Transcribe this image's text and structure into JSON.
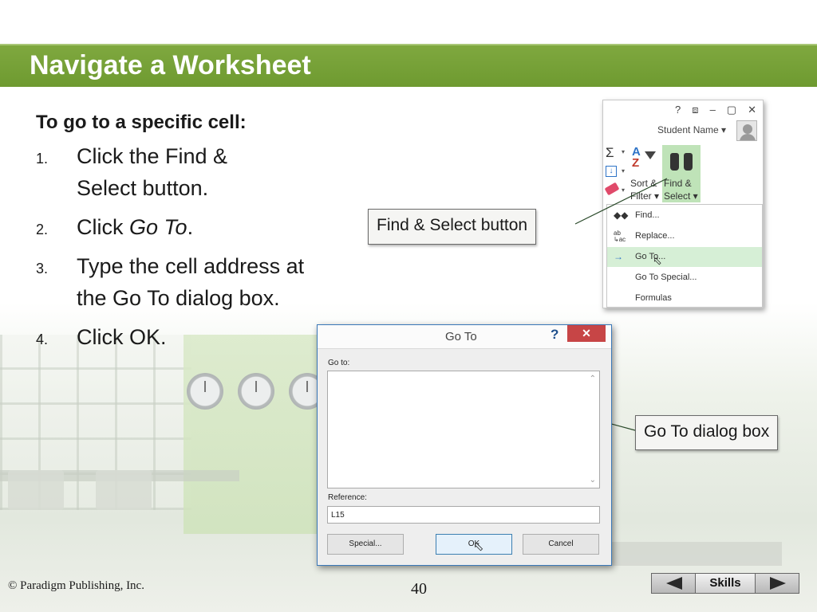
{
  "slide": {
    "title": "Navigate a Worksheet",
    "heading": "To go to a specific cell:",
    "steps": [
      {
        "num": "1.",
        "text_pre": "Click the Find & Select button.",
        "italic": "",
        "text_post": ""
      },
      {
        "num": "2.",
        "text_pre": "Click ",
        "italic": "Go To",
        "text_post": "."
      },
      {
        "num": "3.",
        "text_pre": "Type the cell address at the Go To dialog box.",
        "italic": "",
        "text_post": ""
      },
      {
        "num": "4.",
        "text_pre": "Click OK.",
        "italic": "",
        "text_post": ""
      }
    ]
  },
  "ribbon": {
    "window_controls": {
      "help": "?",
      "restore_ribbon": "⧈",
      "minimize": "–",
      "maximize": "🗗",
      "close": "✕"
    },
    "user_name": "Student Name ▾",
    "sort_filter_label_1": "Sort &",
    "sort_filter_label_2": "Filter ▾",
    "find_select_label_1": "Find &",
    "find_select_label_2": "Select ▾",
    "menu_items": [
      {
        "label": "Find...",
        "icon": "binoculars-icon",
        "glyph": "🔭"
      },
      {
        "label": "Replace...",
        "icon": "replace-icon",
        "glyph": "ab↳ac"
      },
      {
        "label": "Go To...",
        "icon": "arrow-right-icon",
        "glyph": "→"
      },
      {
        "label": "Go To Special...",
        "icon": "",
        "glyph": ""
      },
      {
        "label": "Formulas",
        "icon": "",
        "glyph": ""
      }
    ],
    "highlight_color": "#d6efd6"
  },
  "callouts": {
    "find_select": "Find & Select button",
    "goto_dialog": "Go To dialog box"
  },
  "dialog": {
    "title": "Go To",
    "help": "?",
    "close": "✕",
    "goto_label": "Go to:",
    "reference_label": "Reference:",
    "reference_value": "L15",
    "special_button": "Special...",
    "ok_button": "OK",
    "cancel_button": "Cancel"
  },
  "footer": {
    "copyright": "© Paradigm Publishing, Inc.",
    "page_number": "40",
    "skills_label": "Skills"
  },
  "colors": {
    "title_bar": "#7fa83f",
    "dialog_border": "#3a78b8",
    "close_button": "#c74546"
  }
}
